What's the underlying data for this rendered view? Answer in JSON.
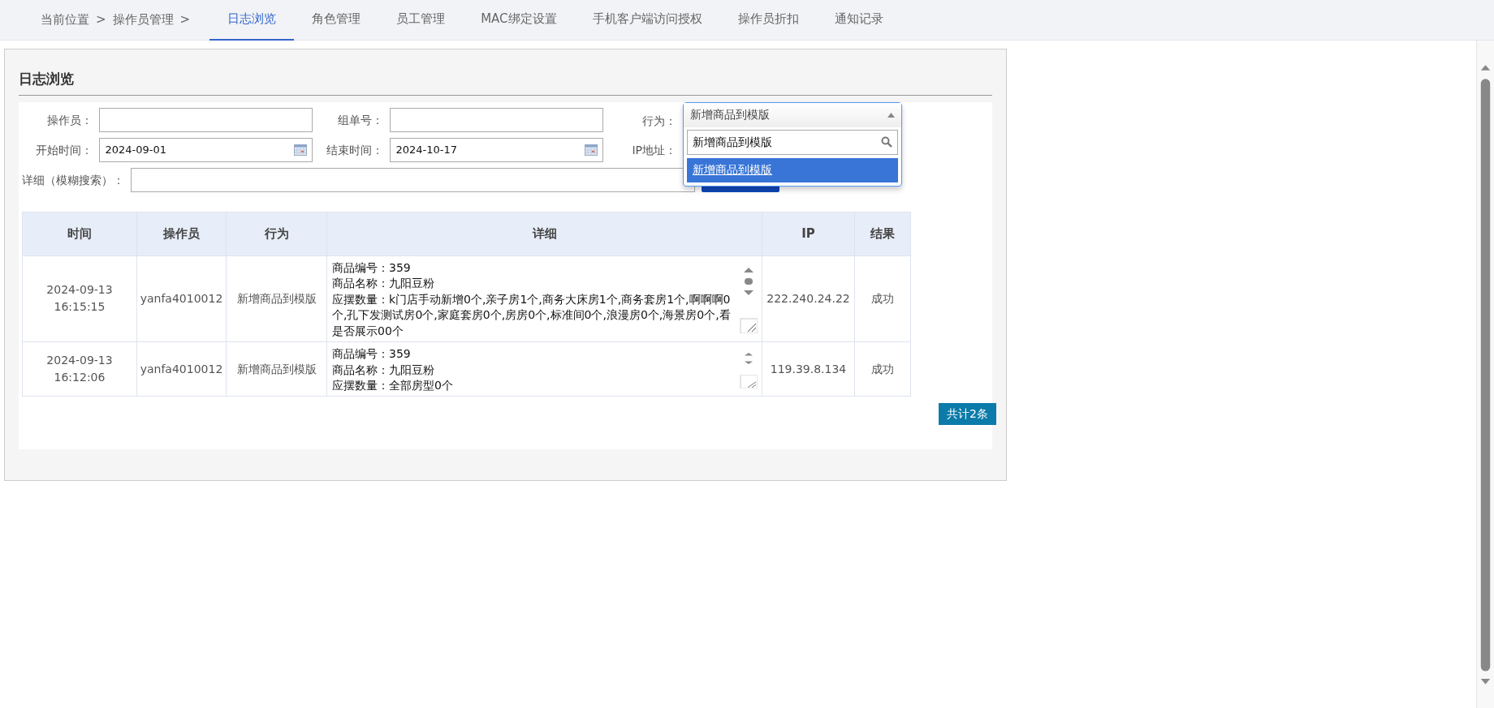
{
  "breadcrumb": [
    "当前位置",
    ">",
    "操作员管理",
    ">"
  ],
  "tabs": [
    {
      "label": "日志浏览",
      "selected": true
    },
    {
      "label": "角色管理",
      "selected": false
    },
    {
      "label": "员工管理",
      "selected": false
    },
    {
      "label": "MAC绑定设置",
      "selected": false
    },
    {
      "label": "手机客户端访问授权",
      "selected": false
    },
    {
      "label": "操作员折扣",
      "selected": false
    },
    {
      "label": "通知记录",
      "selected": false
    }
  ],
  "panel_title": "日志浏览",
  "filter_rows": [
    [
      {
        "label": "操作员：",
        "kind": "text"
      },
      {
        "label": "组单号：",
        "kind": "text"
      },
      {
        "label": "行为：",
        "kind": "select",
        "value": "新增商品到模版",
        "expanded": true,
        "search": "新增商品到模版",
        "options": [
          {
            "label": "新增商品到模版",
            "selected": true
          }
        ]
      }
    ],
    [
      {
        "label": "开始时间：",
        "kind": "date",
        "value": "2024-09-01"
      },
      {
        "label": "结束时间：",
        "kind": "date",
        "value": "2024-10-17"
      },
      {
        "label": "IP地址：",
        "kind": "covered"
      }
    ],
    [
      {
        "label": "详细（模糊搜索）：",
        "kind": "wide"
      },
      {
        "kind": "button"
      }
    ]
  ],
  "table": {
    "columns": [
      "时间",
      "操作员",
      "行为",
      "详细",
      "IP",
      "结果"
    ],
    "rows": [
      {
        "time": "2024-09-13 16:15:15",
        "operator": "yanfa4010012",
        "action": "新增商品到模版",
        "detail": [
          "商品编号：359",
          "商品名称：九阳豆粉",
          "应摆数量：k门店手动新增0个,亲子房1个,商务大床房1个,商务套房1个,啊啊啊0个,孔下发测试房0个,家庭套房0个,房房0个,标准间0个,浪漫房0个,海景房0个,看是否展示00个"
        ],
        "ip": "222.240.24.22",
        "result": "成功"
      },
      {
        "time": "2024-09-13 16:12:06",
        "operator": "yanfa4010012",
        "action": "新增商品到模版",
        "detail": [
          "商品编号：359",
          "商品名称：九阳豆粉",
          "应摆数量：全部房型0个"
        ],
        "ip": "119.39.8.134",
        "result": "成功"
      }
    ]
  },
  "total": "共计2条"
}
